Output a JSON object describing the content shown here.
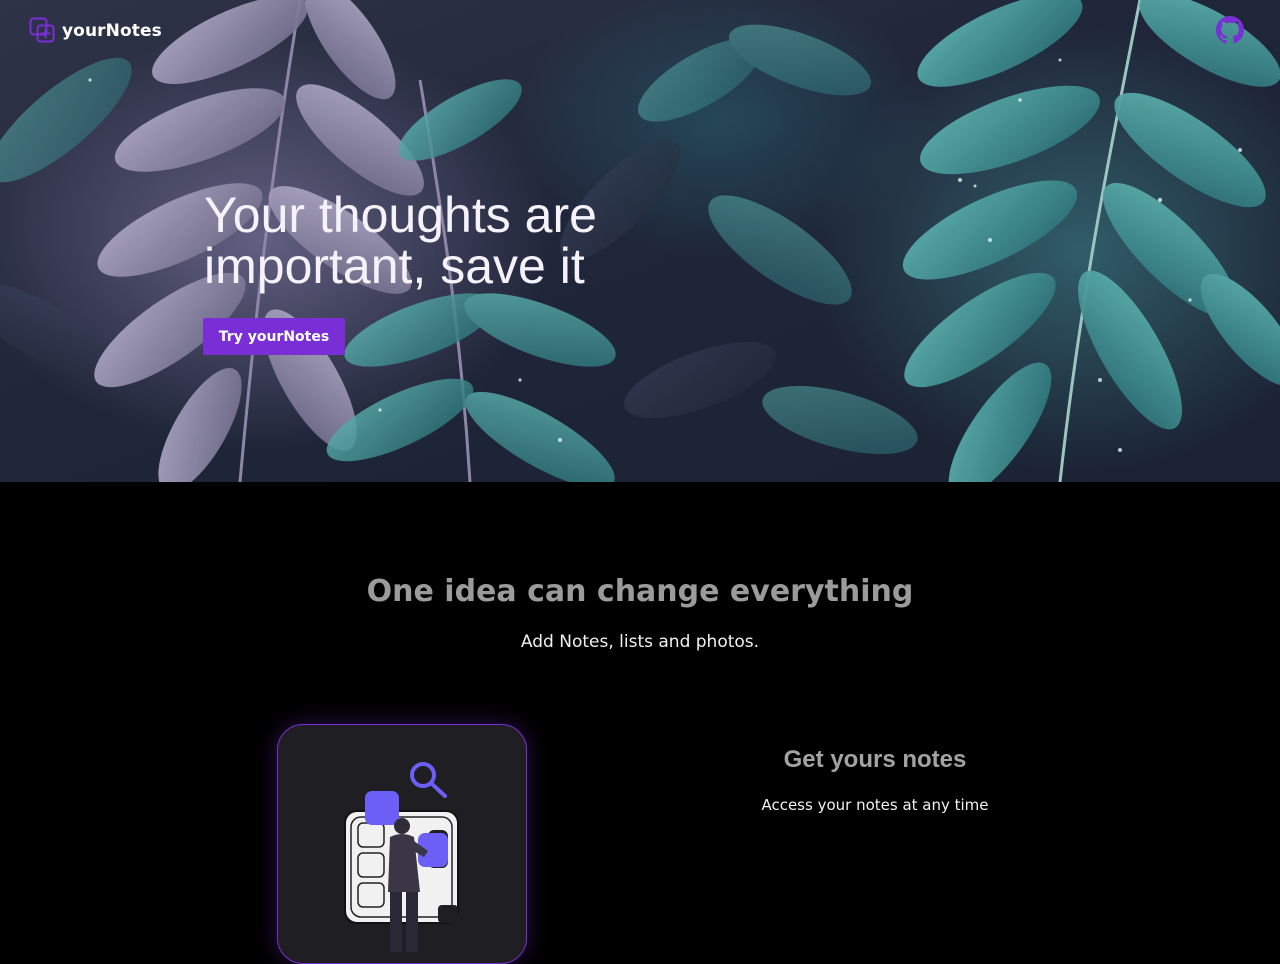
{
  "brand": {
    "name": "yourNotes"
  },
  "hero": {
    "title": "Your thoughts are important, save it",
    "cta_label": "Try yourNotes"
  },
  "section": {
    "title": "One idea can change everything",
    "subtitle": "Add Notes, lists and photos."
  },
  "feature": {
    "title": "Get yours notes",
    "description": "Access your notes at any time"
  },
  "icons": {
    "logo": "add-note-icon",
    "github": "github-icon",
    "search": "search-icon"
  },
  "colors": {
    "accent": "#7a2fd6",
    "illustration_accent": "#6c5ff7",
    "page_background": "#000000",
    "card_background": "#1f1e22"
  }
}
